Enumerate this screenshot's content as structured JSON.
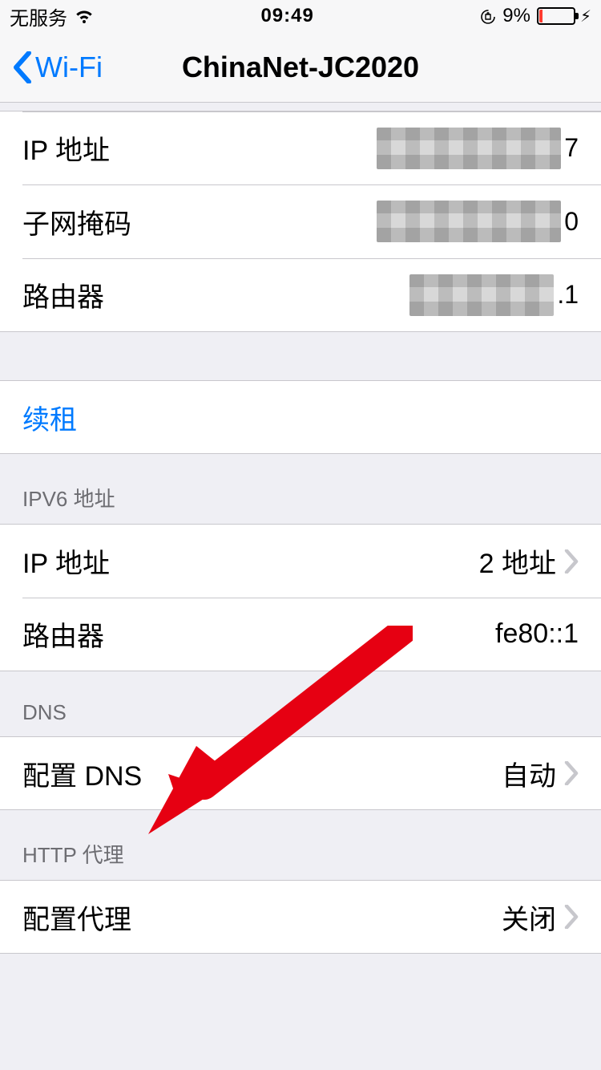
{
  "status": {
    "carrier": "无服务",
    "time": "09:49",
    "battery_pct": "9%"
  },
  "nav": {
    "back_label": "Wi-Fi",
    "title": "ChinaNet-JC2020"
  },
  "ipv4": {
    "ip_label": "IP 地址",
    "ip_suffix": "7",
    "subnet_label": "子网掩码",
    "subnet_suffix": "0",
    "router_label": "路由器",
    "router_suffix": ".1"
  },
  "renew": {
    "label": "续租"
  },
  "ipv6": {
    "header": "IPV6 地址",
    "ip_label": "IP 地址",
    "ip_value": "2 地址",
    "router_label": "路由器",
    "router_value": "fe80::1"
  },
  "dns": {
    "header": "DNS",
    "config_label": "配置 DNS",
    "config_value": "自动"
  },
  "proxy": {
    "header": "HTTP 代理",
    "config_label": "配置代理",
    "config_value": "关闭"
  }
}
